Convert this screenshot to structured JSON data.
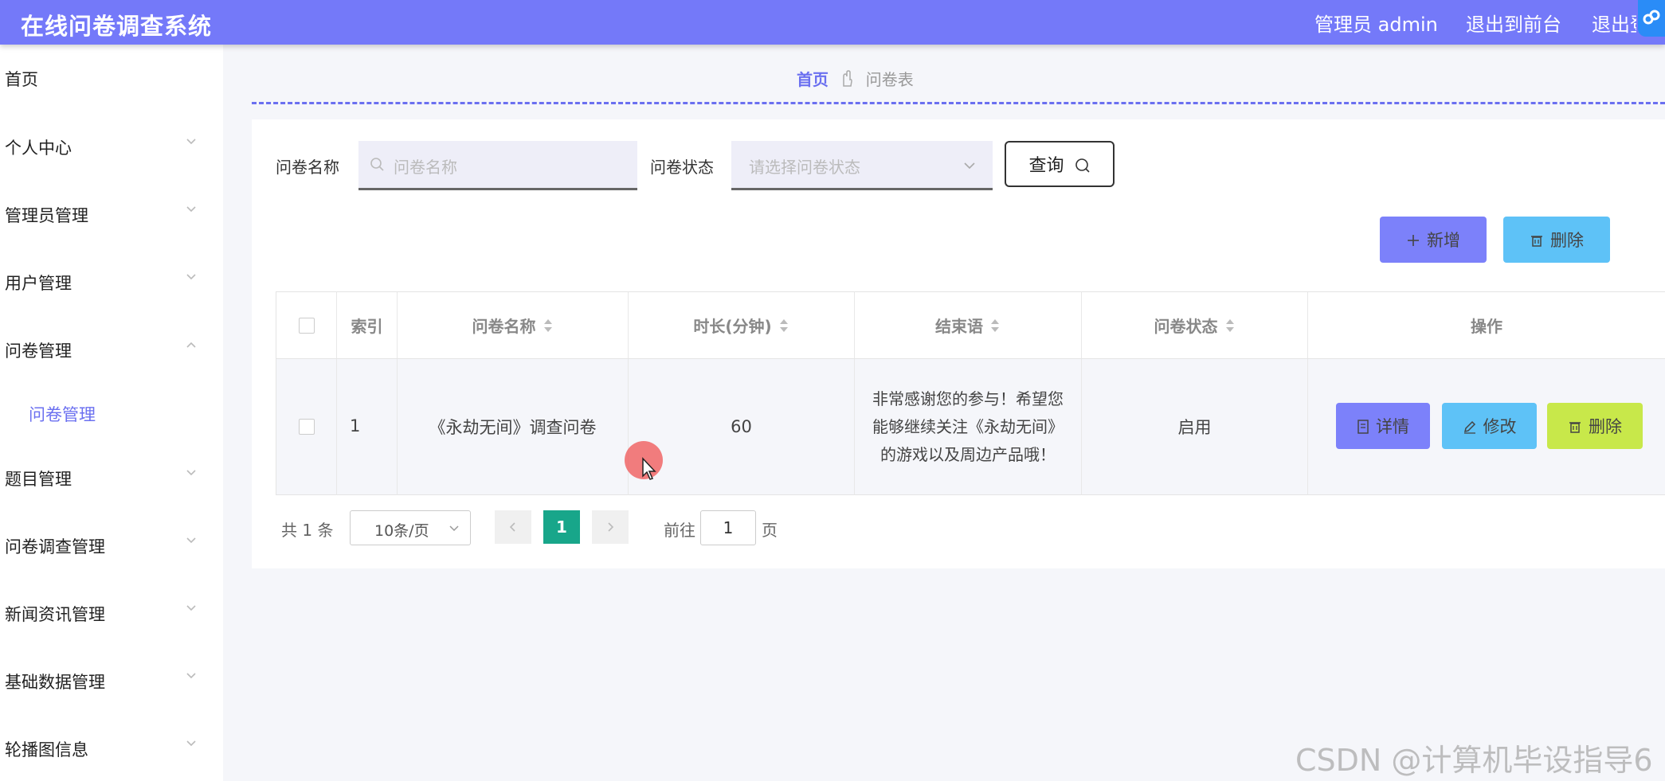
{
  "header": {
    "title": "在线问卷调查系统",
    "user": "管理员 admin",
    "to_front": "退出到前台",
    "logout": "退出登录"
  },
  "sidebar": {
    "items": [
      {
        "label": "首页"
      },
      {
        "label": "个人中心"
      },
      {
        "label": "管理员管理"
      },
      {
        "label": "用户管理"
      },
      {
        "label": "问卷管理"
      },
      {
        "label": "题目管理"
      },
      {
        "label": "问卷调查管理"
      },
      {
        "label": "新闻资讯管理"
      },
      {
        "label": "基础数据管理"
      },
      {
        "label": "轮播图信息"
      }
    ],
    "sub_item": "问卷管理"
  },
  "breadcrumb": {
    "home": "首页",
    "current": "问卷表"
  },
  "search": {
    "name_label": "问卷名称",
    "name_placeholder": "问卷名称",
    "status_label": "问卷状态",
    "status_placeholder": "请选择问卷状态",
    "query_label": "查询"
  },
  "actions": {
    "add_label": "新增",
    "delete_label": "删除"
  },
  "table": {
    "columns": [
      "索引",
      "问卷名称",
      "时长(分钟)",
      "结束语",
      "问卷状态",
      "操作"
    ],
    "rows": [
      {
        "index": "1",
        "name": "《永劫无间》调查问卷",
        "duration": "60",
        "closing": "非常感谢您的参与！希望您能够继续关注《永劫无间》的游戏以及周边产品哦！",
        "status": "启用",
        "detail_label": "详情",
        "edit_label": "修改",
        "delete_label": "删除"
      }
    ]
  },
  "pagination": {
    "total": "共 1 条",
    "page_size": "10条/页",
    "current_page": "1",
    "goto_label": "前往",
    "goto_value": "1",
    "page_suffix": "页"
  },
  "watermark": "CSDN @计算机毕设指导6",
  "colors": {
    "header_bg": "#7479f9",
    "accent": "#6b70f0",
    "add_button": "#7c81fa",
    "delete_button": "#5ec2f7",
    "row_delete_button": "#c8e84a",
    "current_page": "#18a68a"
  }
}
